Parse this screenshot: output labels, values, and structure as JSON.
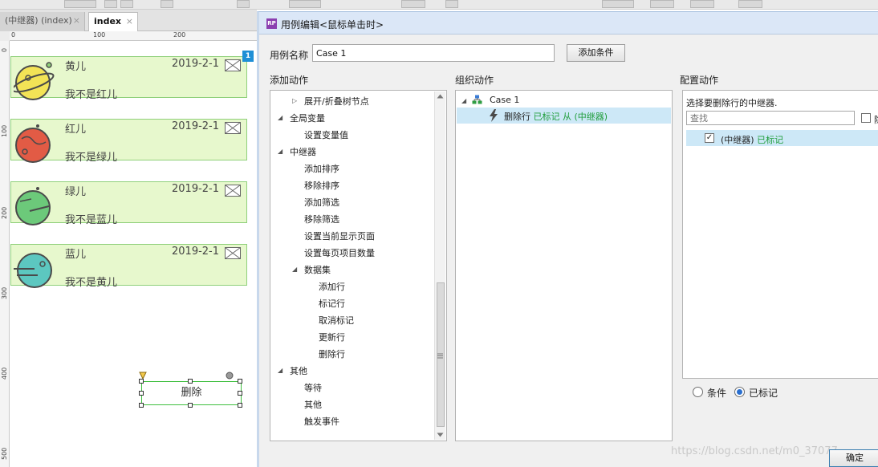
{
  "tabs": [
    {
      "label": "(中继器) (index)",
      "close": "×"
    },
    {
      "label": "index",
      "close": "×"
    }
  ],
  "ruler": {
    "h_labels": [
      "0",
      "100",
      "200"
    ],
    "v_labels": [
      "0",
      "100",
      "200",
      "300",
      "400",
      "500"
    ]
  },
  "repeater": {
    "badge": "1",
    "rows": [
      {
        "name": "黄儿",
        "date": "2019-2-1",
        "desc": "我不是红儿",
        "planet_color": "#f3e356"
      },
      {
        "name": "红儿",
        "date": "2019-2-1",
        "desc": "我不是绿儿",
        "planet_color": "#e25b45"
      },
      {
        "name": "绿儿",
        "date": "2019-2-1",
        "desc": "我不是蓝儿",
        "planet_color": "#6cc97a"
      },
      {
        "name": "蓝儿",
        "date": "2019-2-1",
        "desc": "我不是黄儿",
        "planet_color": "#5cc7c0"
      }
    ]
  },
  "delete_button": {
    "label": "删除"
  },
  "dialog": {
    "icon_text": "RP",
    "title": "用例编辑<鼠标单击时>",
    "case_name_label": "用例名称",
    "case_name_value": "Case 1",
    "add_condition_button": "添加条件",
    "add_action_header": "添加动作",
    "organize_action_header": "组织动作",
    "configure_action_header": "配置动作",
    "actions_tree": [
      {
        "label": "展开/折叠树节点",
        "level": 1,
        "arrow": "▷"
      },
      {
        "label": "全局变量",
        "level": 0,
        "arrow": "◢"
      },
      {
        "label": "设置变量值",
        "level": 1,
        "arrow": ""
      },
      {
        "label": "中继器",
        "level": 0,
        "arrow": "◢"
      },
      {
        "label": "添加排序",
        "level": 1,
        "arrow": ""
      },
      {
        "label": "移除排序",
        "level": 1,
        "arrow": ""
      },
      {
        "label": "添加筛选",
        "level": 1,
        "arrow": ""
      },
      {
        "label": "移除筛选",
        "level": 1,
        "arrow": ""
      },
      {
        "label": "设置当前显示页面",
        "level": 1,
        "arrow": ""
      },
      {
        "label": "设置每页项目数量",
        "level": 1,
        "arrow": ""
      },
      {
        "label": "数据集",
        "level": 1,
        "arrow": "◢"
      },
      {
        "label": "添加行",
        "level": 2,
        "arrow": ""
      },
      {
        "label": "标记行",
        "level": 2,
        "arrow": ""
      },
      {
        "label": "取消标记",
        "level": 2,
        "arrow": ""
      },
      {
        "label": "更新行",
        "level": 2,
        "arrow": ""
      },
      {
        "label": "删除行",
        "level": 2,
        "arrow": ""
      },
      {
        "label": "其他",
        "level": 0,
        "arrow": "◢"
      },
      {
        "label": "等待",
        "level": 1,
        "arrow": ""
      },
      {
        "label": "其他",
        "level": 1,
        "arrow": ""
      },
      {
        "label": "触发事件",
        "level": 1,
        "arrow": ""
      }
    ],
    "organize": {
      "case_label": "Case 1",
      "action_prefix": "删除行",
      "action_marked": "已标记",
      "action_from": "从",
      "action_target": "(中继器)"
    },
    "configure": {
      "instruction": "选择要删除行的中继器.",
      "search_placeholder": "查找",
      "hide_label": "隐",
      "repeater_item": "(中继器)",
      "repeater_item_marked": "已标记",
      "radio_condition": "条件",
      "radio_marked": "已标记"
    },
    "ok_button": "确定"
  },
  "watermark": "https://blog.csdn.net/m0_37077"
}
